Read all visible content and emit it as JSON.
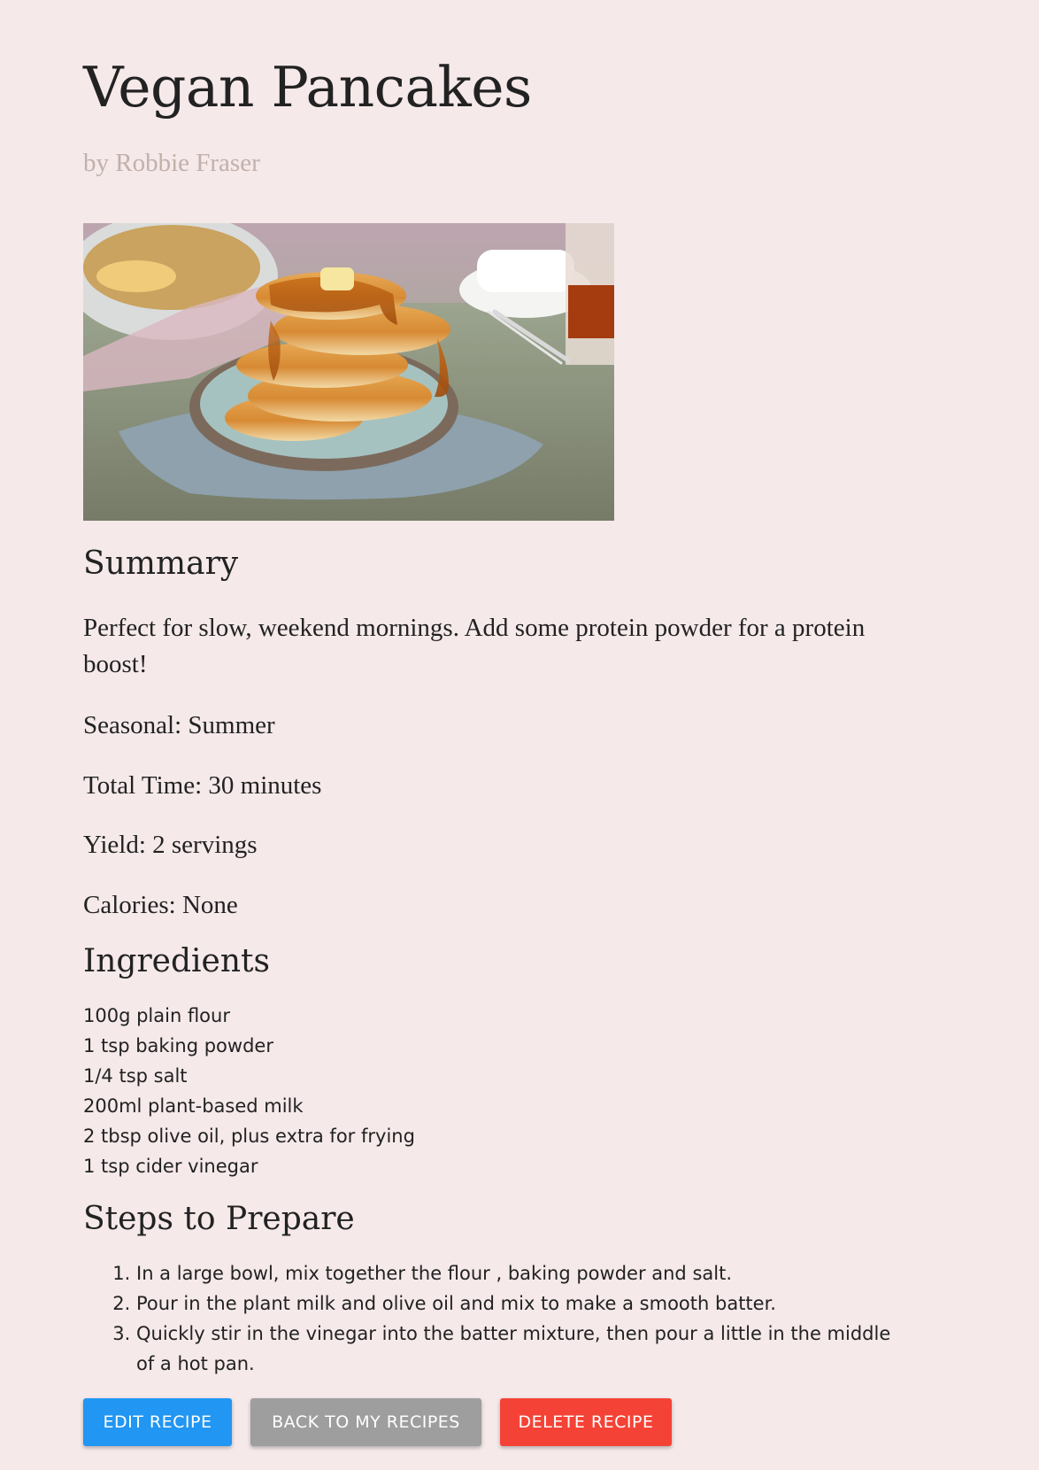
{
  "recipe": {
    "title": "Vegan Pancakes",
    "author": "by Robbie Fraser",
    "image_alt": "stack of pancakes with syrup"
  },
  "summary": {
    "heading": "Summary",
    "text": "Perfect for slow, weekend mornings. Add some protein powder for a protein boost!",
    "seasonal": "Seasonal: Summer",
    "total_time": "Total Time: 30 minutes",
    "yield": "Yield: 2 servings",
    "calories": "Calories: None"
  },
  "ingredients": {
    "heading": "Ingredients",
    "items": [
      "100g plain flour",
      "1 tsp baking powder",
      "1/4 tsp salt",
      "200ml plant-based milk",
      "2 tbsp olive oil, plus extra for frying",
      "1 tsp cider vinegar"
    ]
  },
  "steps": {
    "heading": "Steps to Prepare",
    "items": [
      "In a large bowl, mix together the flour , baking powder and salt.",
      "Pour in the plant milk and olive oil and mix to make a smooth batter.",
      "Quickly stir in the vinegar into the batter mixture, then pour a little in the middle of a hot pan."
    ]
  },
  "actions": {
    "edit_label": "EDIT RECIPE",
    "back_label": "BACK TO MY RECIPES",
    "delete_label": "DELETE RECIPE"
  },
  "colors": {
    "page_background": "#f5e9ea",
    "author": "#c2b0aa",
    "edit_button": "#2196f3",
    "back_button": "#9e9e9e",
    "delete_button": "#f44336"
  }
}
